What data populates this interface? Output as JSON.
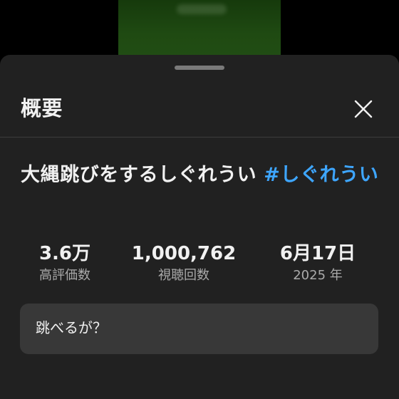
{
  "panel": {
    "title": "概要"
  },
  "video": {
    "title_text": "大縄跳びをするしぐれうい ",
    "hashtag": "#しぐれうい"
  },
  "stats": [
    {
      "value": "3.6万",
      "label": "高評価数"
    },
    {
      "value": "1,000,762",
      "label": "視聴回数"
    },
    {
      "value": "6月17日",
      "label": "2025 年"
    }
  ],
  "description": {
    "text": "跳べるが？"
  },
  "icons": {
    "close": "close-icon",
    "drag_handle": "drag-handle"
  },
  "colors": {
    "sheet_background": "#212121",
    "text_primary": "#f1f1f1",
    "text_secondary": "#aaaaaa",
    "hashtag": "#3ea6ff",
    "description_background": "#383838"
  }
}
